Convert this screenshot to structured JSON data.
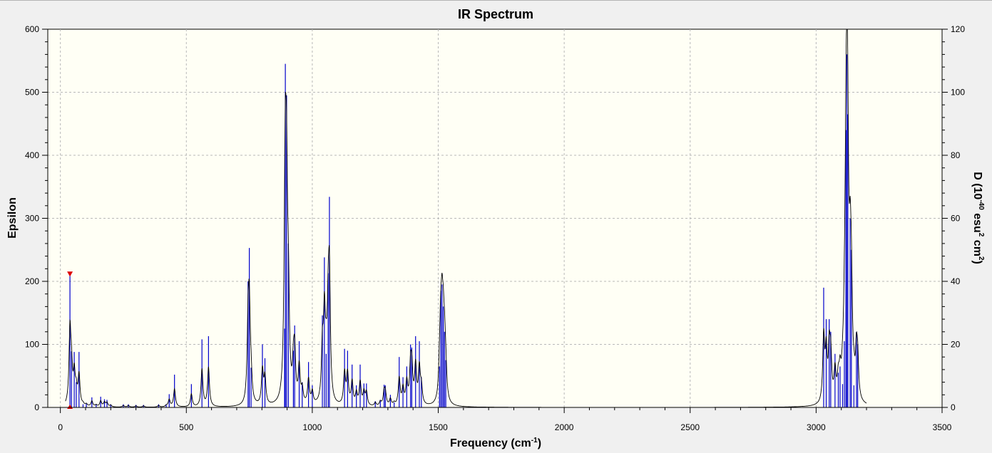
{
  "window": {
    "title": "IR Spectrum"
  },
  "chart_data": {
    "type": "line",
    "title": "IR Spectrum",
    "xlabel": "Frequency (cm",
    "xlabel_sup": "-1",
    "xlabel_end": ")",
    "ylabel": "Epsilon",
    "y2label_parts": [
      "D (10",
      "-40",
      " esu",
      "2",
      " cm",
      "2",
      ")"
    ],
    "xlim": [
      -50,
      3500
    ],
    "ylim": [
      0,
      600
    ],
    "y2lim": [
      0,
      120
    ],
    "x_ticks": [
      "0",
      "500",
      "1000",
      "1500",
      "2000",
      "2500",
      "3000",
      "3500"
    ],
    "y_ticks": [
      "0",
      "100",
      "200",
      "300",
      "400",
      "500",
      "600"
    ],
    "y2_ticks": [
      "0",
      "20",
      "40",
      "60",
      "80",
      "100",
      "120"
    ],
    "grid": true,
    "colors": {
      "plot_bg": "#fffff5",
      "spectrum": "#000000",
      "sticks": "#0000cc",
      "marker": "#dd0000",
      "grid": "#b8b8b8"
    },
    "marker": {
      "x": 38,
      "y": 211
    },
    "sticks": [
      [
        38,
        211
      ],
      [
        44,
        89
      ],
      [
        55,
        88
      ],
      [
        63,
        40
      ],
      [
        74,
        88
      ],
      [
        90,
        5
      ],
      [
        103,
        6
      ],
      [
        125,
        16
      ],
      [
        142,
        5
      ],
      [
        160,
        17
      ],
      [
        175,
        13
      ],
      [
        185,
        12
      ],
      [
        200,
        5
      ],
      [
        250,
        5
      ],
      [
        270,
        5
      ],
      [
        300,
        4
      ],
      [
        330,
        4
      ],
      [
        390,
        5
      ],
      [
        420,
        4
      ],
      [
        432,
        21
      ],
      [
        453,
        52
      ],
      [
        520,
        37
      ],
      [
        562,
        108
      ],
      [
        588,
        113
      ],
      [
        745,
        200
      ],
      [
        750,
        253
      ],
      [
        757,
        63
      ],
      [
        802,
        100
      ],
      [
        812,
        78
      ],
      [
        890,
        125
      ],
      [
        893,
        545
      ],
      [
        898,
        495
      ],
      [
        905,
        260
      ],
      [
        925,
        90
      ],
      [
        930,
        130
      ],
      [
        948,
        105
      ],
      [
        960,
        40
      ],
      [
        985,
        72
      ],
      [
        1000,
        35
      ],
      [
        1040,
        146
      ],
      [
        1048,
        238
      ],
      [
        1055,
        85
      ],
      [
        1063,
        213
      ],
      [
        1068,
        334
      ],
      [
        1128,
        93
      ],
      [
        1140,
        90
      ],
      [
        1158,
        68
      ],
      [
        1175,
        35
      ],
      [
        1190,
        68
      ],
      [
        1205,
        38
      ],
      [
        1215,
        38
      ],
      [
        1250,
        10
      ],
      [
        1270,
        12
      ],
      [
        1285,
        36
      ],
      [
        1290,
        35
      ],
      [
        1310,
        20
      ],
      [
        1325,
        8
      ],
      [
        1345,
        80
      ],
      [
        1360,
        48
      ],
      [
        1375,
        65
      ],
      [
        1390,
        100
      ],
      [
        1395,
        95
      ],
      [
        1410,
        113
      ],
      [
        1425,
        105
      ],
      [
        1433,
        48
      ],
      [
        1505,
        65
      ],
      [
        1510,
        185
      ],
      [
        1515,
        195
      ],
      [
        1520,
        160
      ],
      [
        1525,
        120
      ],
      [
        1530,
        75
      ],
      [
        3030,
        190
      ],
      [
        3040,
        140
      ],
      [
        3052,
        140
      ],
      [
        3058,
        120
      ],
      [
        3075,
        85
      ],
      [
        3088,
        55
      ],
      [
        3095,
        65
      ],
      [
        3105,
        37
      ],
      [
        3112,
        105
      ],
      [
        3118,
        440
      ],
      [
        3122,
        560
      ],
      [
        3126,
        465
      ],
      [
        3135,
        300
      ],
      [
        3140,
        250
      ],
      [
        3150,
        35
      ],
      [
        3160,
        120
      ],
      [
        3165,
        100
      ]
    ]
  }
}
